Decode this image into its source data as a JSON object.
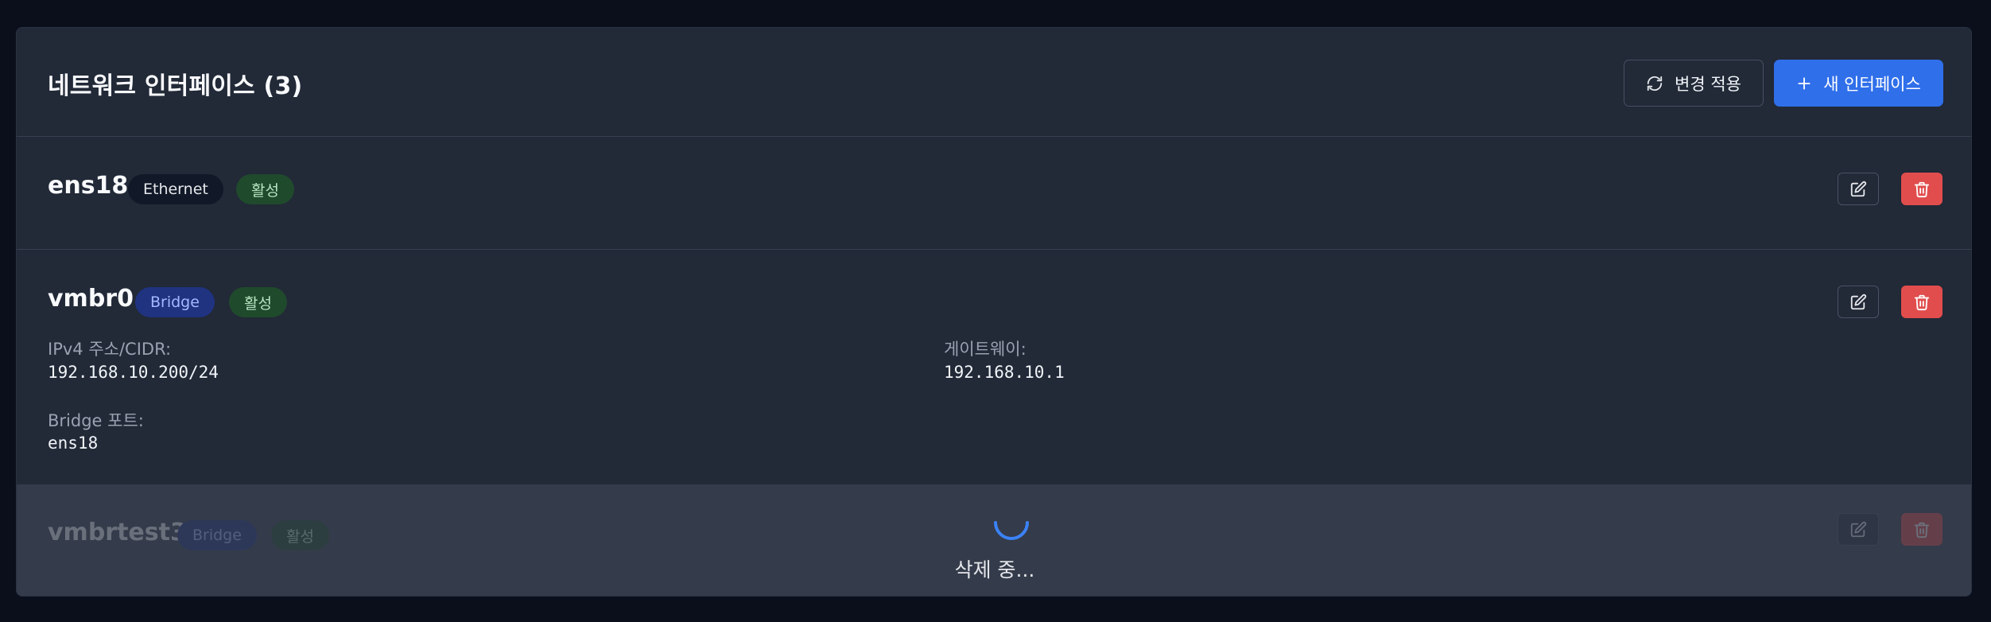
{
  "header": {
    "title": "네트워크 인터페이스 (3)",
    "apply_label": "변경 적용",
    "new_label": "새 인터페이스"
  },
  "interfaces": [
    {
      "name": "ens18",
      "type": "Ethernet",
      "status": "활성"
    },
    {
      "name": "vmbr0",
      "type": "Bridge",
      "status": "활성",
      "ipv4_label": "IPv4 주소/CIDR:",
      "ipv4_value": "192.168.10.200/24",
      "gateway_label": "게이트웨이:",
      "gateway_value": "192.168.10.1",
      "ports_label": "Bridge 포트:",
      "ports_value": "ens18"
    },
    {
      "name": "vmbrtest3",
      "type": "Bridge",
      "status": "활성",
      "overlay_text": "삭제 중..."
    }
  ],
  "icons": {
    "refresh": "refresh-icon",
    "plus": "plus-icon",
    "edit": "edit-icon",
    "delete": "trash-icon",
    "spinner": "spinner-icon"
  },
  "colors": {
    "primary": "#2f6fea",
    "danger": "#e14d4d",
    "panel": "#222937",
    "background": "#0b0f1c"
  }
}
